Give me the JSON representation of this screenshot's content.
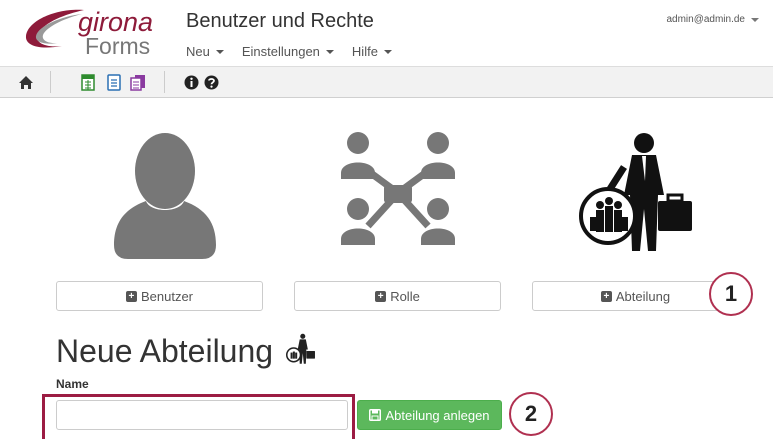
{
  "brand": {
    "line1": "girona",
    "line2": "Forms"
  },
  "app_title": "Benutzer und Rechte",
  "menu": {
    "items": [
      {
        "label": "Neu"
      },
      {
        "label": "Einstellungen"
      },
      {
        "label": "Hilfe"
      }
    ]
  },
  "user": {
    "email": "admin@admin.de"
  },
  "toolbar": {
    "icons": [
      "home-icon",
      "spreadsheet-icon",
      "document-icon",
      "documents-icon",
      "info-icon",
      "help-icon"
    ]
  },
  "cards": {
    "user": {
      "label": "Benutzer"
    },
    "role": {
      "label": "Rolle"
    },
    "department": {
      "label": "Abteilung"
    }
  },
  "callouts": {
    "one": "1",
    "two": "2"
  },
  "form": {
    "title": "Neue Abteilung",
    "name_label": "Name",
    "name_value": "",
    "submit_label": "Abteilung anlegen"
  },
  "colors": {
    "brand": "#8e1b3a",
    "primary_green": "#5cb85c",
    "highlight": "#9c1c43",
    "icon_gray": "#777777"
  }
}
